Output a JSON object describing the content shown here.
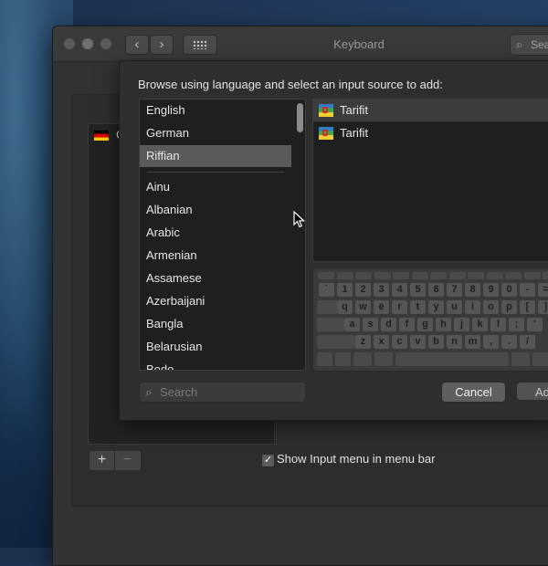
{
  "window": {
    "title": "Keyboard",
    "search_placeholder": "Sea"
  },
  "sheet": {
    "heading": "Browse using language and select an input source to add:",
    "languages_top": [
      "English",
      "German",
      "Riffian"
    ],
    "languages": [
      "Ainu",
      "Albanian",
      "Arabic",
      "Armenian",
      "Assamese",
      "Azerbaijani",
      "Bangla",
      "Belarusian",
      "Bodo"
    ],
    "selected_language": "Riffian",
    "input_sources": [
      "Tarifit",
      "Tarifit"
    ],
    "search_placeholder": "Search",
    "cancel_label": "Cancel",
    "add_label": "Add"
  },
  "background_pane": {
    "current_source_flag": "german-flag-icon",
    "current_source_label": "G",
    "show_input_menu_label": "Show Input menu in menu bar",
    "show_input_menu_checked": true,
    "plus_label": "+",
    "minus_label": "−"
  },
  "keyboard_rows": [
    [
      "`",
      "1",
      "2",
      "3",
      "4",
      "5",
      "6",
      "7",
      "8",
      "9",
      "0",
      "-",
      "="
    ],
    [
      "q",
      "w",
      "e",
      "r",
      "t",
      "y",
      "u",
      "i",
      "o",
      "p",
      "[",
      "]"
    ],
    [
      "a",
      "s",
      "d",
      "f",
      "g",
      "h",
      "j",
      "k",
      "l",
      ";",
      "'"
    ],
    [
      "z",
      "x",
      "c",
      "v",
      "b",
      "n",
      "m",
      ",",
      ".",
      "/"
    ]
  ],
  "colors": {
    "selection": "#5a5a5a",
    "window_bg": "#323232"
  }
}
